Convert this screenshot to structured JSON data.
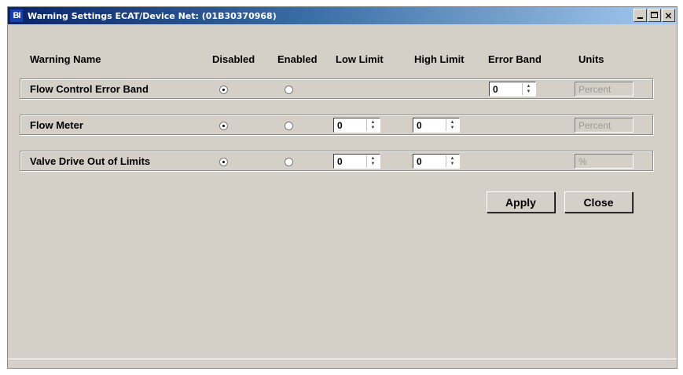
{
  "window": {
    "icon_text": "BI",
    "title": "Warning Settings ECAT/Device Net: (01B30370968)",
    "controls": {
      "minimize": "minimize",
      "maximize": "maximize",
      "close": "×"
    }
  },
  "columns": {
    "name": "Warning Name",
    "disabled": "Disabled",
    "enabled": "Enabled",
    "low_limit": "Low Limit",
    "high_limit": "High Limit",
    "error_band": "Error Band",
    "units": "Units"
  },
  "rows": [
    {
      "name": "Flow Control Error Band",
      "disabled_checked": true,
      "enabled_checked": false,
      "error_band": "0",
      "units": "Percent"
    },
    {
      "name": "Flow Meter",
      "disabled_checked": true,
      "enabled_checked": false,
      "low_limit": "0",
      "high_limit": "0",
      "units": "Percent"
    },
    {
      "name": "Valve Drive Out of Limits",
      "disabled_checked": true,
      "enabled_checked": false,
      "low_limit": "0",
      "high_limit": "0",
      "units": "%"
    }
  ],
  "buttons": {
    "apply": "Apply",
    "close": "Close"
  },
  "colors": {
    "title_start": "#0a246a",
    "title_end": "#a6caf0",
    "face": "#d4d0c8"
  },
  "icons": [
    "app-icon",
    "minimize-icon",
    "maximize-icon",
    "close-icon",
    "spin-up-icon",
    "spin-down-icon"
  ]
}
